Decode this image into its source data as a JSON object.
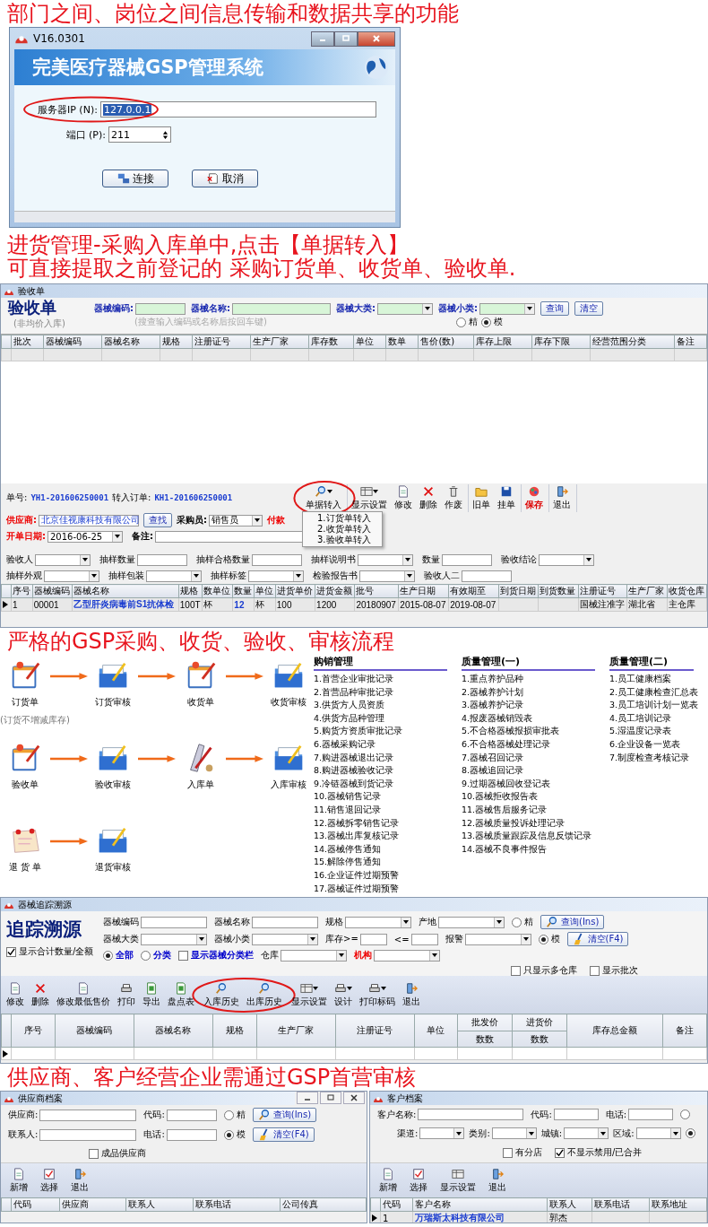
{
  "caption_top": "部门之间、岗位之间信息传输和数据共享的功能",
  "login_window": {
    "title": "V16.0301",
    "banner": "完美医疗器械GSP管理系统",
    "server": {
      "label": "服务器IP (N):",
      "value": "127.0.0.1",
      "highlighted": true
    },
    "port": {
      "label": "端口 (P):",
      "value": "211"
    },
    "buttons": [
      {
        "label": "连接",
        "kind": "connect"
      },
      {
        "label": "取消",
        "kind": "cancel"
      }
    ]
  },
  "caption_purchase": [
    "进货管理-采购入库单中,点击【单据转入】",
    "可直接提取之前登记的 采购订货单、收货单、验收单."
  ],
  "inspection_window": {
    "title": "验收单",
    "heading": "验收单",
    "subheading": "(非均价入库)",
    "filters": [
      {
        "kind": "text",
        "label": "器械编码:"
      },
      {
        "kind": "longtext",
        "label": "器械名称:"
      },
      {
        "kind": "select",
        "label": "器械大类:"
      },
      {
        "kind": "select",
        "label": "器械小类:"
      }
    ],
    "hint": "(搜查输入编码或名称后按回车键)",
    "buttons": [
      "查询",
      "清空"
    ],
    "match_modes": [
      {
        "kind": "radio",
        "label": "精",
        "selected": false
      },
      {
        "kind": "radio",
        "label": "模",
        "selected": true
      }
    ],
    "columns": [
      "批次",
      "器械编码",
      "器械名称",
      "规格",
      "注册证号",
      "生产厂家",
      "库存数",
      "单位",
      "数单",
      "售价(数)",
      "库存上限",
      "库存下限",
      "经营范围分类",
      "备注"
    ]
  },
  "bill": {
    "number_label": "单号:",
    "number": "YH1-201606250001",
    "source_label": "转入订单:",
    "source": "KH1-201606250001",
    "toolbar": [
      {
        "circled": true,
        "items": [
          {
            "label": "单据转入",
            "kind": "transfer",
            "dropdown": true
          }
        ]
      },
      {
        "circled": false,
        "items": [
          {
            "label": "显示设置",
            "kind": "display",
            "dropdown": true
          },
          {
            "label": "修改",
            "kind": "edit",
            "dropdown": false
          },
          {
            "label": "删除",
            "kind": "delete",
            "dropdown": false
          },
          {
            "label": "作废",
            "kind": "void",
            "dropdown": false
          }
        ]
      },
      {
        "circled": false,
        "items": [
          {
            "label": "旧单",
            "kind": "open",
            "dropdown": false
          },
          {
            "label": "挂单",
            "kind": "hold",
            "dropdown": false
          }
        ]
      },
      {
        "circled": false,
        "items": [
          {
            "label": "保存",
            "kind": "save",
            "dropdown": false,
            "color": "#dd0000"
          }
        ]
      },
      {
        "circled": false,
        "items": [
          {
            "label": "退出",
            "kind": "exit",
            "dropdown": false
          }
        ]
      }
    ],
    "menu": [
      "1.订货单转入",
      "2.收货单转入",
      "3.验收单转入"
    ],
    "form_rows": [
      [
        {
          "kind": "lookup",
          "label": "供应商:",
          "color": "#ee0000",
          "value": "北京佳视康科技有限公司"
        },
        {
          "kind": "button",
          "label": "查找"
        },
        {
          "kind": "select",
          "label": "采购员:",
          "value": "销售员"
        },
        {
          "kind": "label",
          "label": "付款",
          "color": "#ee0000"
        }
      ],
      [
        {
          "kind": "select",
          "label": "开单日期:",
          "color": "#ee0000",
          "value": "2016-06-25"
        },
        {
          "kind": "wide",
          "label": "备注:"
        }
      ],
      [
        {
          "kind": "select",
          "label": "验收人"
        },
        {
          "kind": "text",
          "label": "抽样数量"
        },
        {
          "kind": "text",
          "label": "抽样合格数量"
        },
        {
          "kind": "select",
          "label": "抽样说明书"
        },
        {
          "kind": "text",
          "label": "数量"
        },
        {
          "kind": "select",
          "label": "验收结论"
        }
      ],
      [
        {
          "kind": "select",
          "label": "抽样外观"
        },
        {
          "kind": "select",
          "label": "抽样包装"
        },
        {
          "kind": "select",
          "label": "抽样标签"
        },
        {
          "kind": "select",
          "label": "检验报告书"
        },
        {
          "kind": "text",
          "label": "验收人二"
        }
      ]
    ],
    "columns": [
      "序号",
      "器械编码",
      "器械名称",
      "规格",
      "数单位",
      "数量",
      "单位",
      "进货单价",
      "进货金额",
      "批号",
      "生产日期",
      "有效期至",
      "到货日期",
      "到货数量",
      "注册证号",
      "生产厂家",
      "收货仓库"
    ],
    "rows": [
      [
        {
          "text": "1"
        },
        {
          "text": "00001"
        },
        {
          "text": "乙型肝炎病毒前S1抗体检",
          "color": "#1a3cd0"
        },
        {
          "text": "100T"
        },
        {
          "text": "杯"
        },
        {
          "text": "12",
          "color": "#1a3cd0"
        },
        {
          "text": "杯"
        },
        {
          "text": "100"
        },
        {
          "text": "1200"
        },
        {
          "text": "20180907"
        },
        {
          "text": "2015-08-07"
        },
        {
          "text": "2019-08-07"
        },
        null,
        null,
        {
          "text": "国械注准字"
        },
        {
          "text": "湖北省"
        },
        {
          "text": "主仓库"
        }
      ]
    ]
  },
  "caption_flow": "严格的GSP采购、收货、验收、审核流程",
  "flow": {
    "rows": [
      {
        "nodes": [
          {
            "label": "订货单",
            "kind": "notepad"
          },
          {
            "label": "订货审核",
            "kind": "folder"
          },
          {
            "label": "收货单",
            "kind": "notepad"
          },
          {
            "label": "收货审核",
            "kind": "folder"
          }
        ],
        "note": "(订货不增减库存)"
      },
      {
        "nodes": [
          {
            "label": "验收单",
            "kind": "notepad"
          },
          {
            "label": "验收审核",
            "kind": "folder"
          },
          {
            "label": "入库单",
            "kind": "tools"
          },
          {
            "label": "入库审核",
            "kind": "folder"
          }
        ]
      },
      {
        "nodes": [
          {
            "label": "退 货 单",
            "kind": "note"
          },
          {
            "label": "退货审核",
            "kind": "folder"
          }
        ]
      }
    ]
  },
  "report_lists": [
    {
      "title": "购销管理",
      "items": [
        "1.首营企业审批记录",
        "2.首营品种审批记录",
        "3.供货方人员资质",
        "4.供货方品种管理",
        "5.购货方资质审批记录",
        "6.器械采购记录",
        "7.购进器械退出记录",
        "8.购进器械验收记录",
        "9.冷链器械到货记录",
        "10.器械销售记录",
        "11.销售退回记录",
        "12.器械拆零销售记录",
        "13.器械出库复核记录",
        "14.器械停售通知",
        "15.解除停售通知",
        "16.企业证件过期预警",
        "17.器械证件过期预警"
      ]
    },
    {
      "title": "质量管理(一)",
      "items": [
        "1.重点养护品种",
        "2.器械养护计划",
        "3.器械养护记录",
        "4.报废器械销毁表",
        "5.不合格器械报损审批表",
        "6.不合格器械处理记录",
        "7.器械召回记录",
        "8.器械追回记录",
        "9.过期器械回收登记表",
        "10.器械拒收报告表",
        "11.器械售后服务记录",
        "12.器械质量投诉处理记录",
        "13.器械质量跟踪及信息反馈记录",
        "14.器械不良事件报告"
      ]
    },
    {
      "title": "质量管理(二)",
      "items": [
        "1.员工健康档案",
        "2.员工健康检查汇总表",
        "3.员工培训计划一览表",
        "4.员工培训记录",
        "5.湿温度记录表",
        "6.企业设备一览表",
        "7.制度检查考核记录"
      ]
    }
  ],
  "trace_window": {
    "title": "器械追踪溯源",
    "heading": "追踪溯源",
    "summary_checkbox": {
      "kind": "checkbox",
      "label": "显示合计数量/全额",
      "checked": true
    },
    "filter_rows": [
      [
        {
          "kind": "text",
          "label": "器械编码"
        },
        {
          "kind": "text",
          "label": "器械名称"
        },
        {
          "kind": "select",
          "label": "规格"
        },
        {
          "kind": "select",
          "label": "产地"
        },
        {
          "kind": "radio",
          "label": "精",
          "selected": false
        },
        {
          "kind": "query",
          "label": "查询(Ins)"
        }
      ],
      [
        {
          "kind": "select",
          "label": "器械大类"
        },
        {
          "kind": "select",
          "label": "器械小类"
        },
        {
          "kind": "short",
          "label": "库存>="
        },
        {
          "kind": "short",
          "label": "<="
        },
        {
          "kind": "select",
          "label": "报警"
        },
        {
          "kind": "radio",
          "label": "模",
          "selected": true
        },
        {
          "kind": "clear",
          "label": "清空(F4)"
        }
      ],
      [
        {
          "kind": "radio",
          "label": "全部",
          "selected": true,
          "color": "#0000cc"
        },
        {
          "kind": "radio",
          "label": "分类",
          "selected": false,
          "color": "#0000cc"
        },
        {
          "kind": "checkbox",
          "label": "显示器械分类栏",
          "checked": false,
          "color": "#0000cc"
        },
        {
          "kind": "select",
          "label": "仓库"
        },
        {
          "kind": "select",
          "label": "机构",
          "color": "#ee0000"
        }
      ],
      [
        {
          "kind": "checkbox",
          "label": "只显示多仓库",
          "checked": false
        },
        {
          "kind": "checkbox",
          "label": "显示批次",
          "checked": false
        }
      ]
    ],
    "toolbar": [
      {
        "circled": false,
        "items": [
          {
            "label": "修改",
            "kind": "edit",
            "dropdown": false
          },
          {
            "label": "删除",
            "kind": "delete",
            "dropdown": false
          },
          {
            "label": "修改最低售价",
            "kind": "edit",
            "dropdown": false
          },
          {
            "label": "打印",
            "kind": "print",
            "dropdown": false
          },
          {
            "label": "导出",
            "kind": "export",
            "dropdown": false
          },
          {
            "label": "盘点表",
            "kind": "export",
            "dropdown": false
          }
        ]
      },
      {
        "circled": true,
        "items": [
          {
            "label": "入库历史",
            "kind": "history",
            "dropdown": false
          },
          {
            "label": "出库历史",
            "kind": "history",
            "dropdown": false
          }
        ]
      },
      {
        "circled": false,
        "items": [
          {
            "label": "显示设置",
            "kind": "display",
            "dropdown": true
          },
          {
            "label": "设计",
            "kind": "print",
            "dropdown": true
          },
          {
            "label": "打印标码",
            "kind": "print",
            "dropdown": true
          },
          {
            "label": "退出",
            "kind": "exit",
            "dropdown": false
          }
        ]
      }
    ],
    "columns": [
      {
        "label": "序号"
      },
      {
        "label": "器械编码"
      },
      {
        "label": "器械名称"
      },
      {
        "label": "规格"
      },
      {
        "label": "生产厂家"
      },
      {
        "label": "注册证号"
      },
      {
        "label": "单位"
      },
      {
        "label": "批发价",
        "sub": "数数"
      },
      {
        "label": "进货价",
        "sub": "数数"
      },
      {
        "label": "库存总金额"
      },
      {
        "label": "备注"
      }
    ]
  },
  "caption_audit": "供应商、客户经营企业需通过GSP首营审核",
  "supplier_window": {
    "title": "供应商档案",
    "filter_rows": [
      [
        {
          "kind": "longtext",
          "label": "供应商:"
        },
        {
          "kind": "text",
          "label": "代码:"
        },
        {
          "kind": "radio",
          "label": "精",
          "selected": false
        },
        {
          "kind": "query",
          "label": "查询(Ins)"
        }
      ],
      [
        {
          "kind": "longtext",
          "label": "联系人:"
        },
        {
          "kind": "text",
          "label": "电话:"
        },
        {
          "kind": "radio",
          "label": "模",
          "selected": true
        },
        {
          "kind": "clear",
          "label": "清空(F4)"
        }
      ],
      [
        {
          "kind": "checkbox",
          "label": "成品供应商",
          "checked": false
        }
      ]
    ],
    "toolbar": [
      {
        "label": "新增",
        "kind": "add",
        "dropdown": false
      },
      {
        "label": "选择",
        "kind": "select",
        "dropdown": false
      },
      {
        "label": "退出",
        "kind": "exit",
        "dropdown": false
      }
    ],
    "columns": [
      "代码",
      "供应商",
      "联系人",
      "联系电话",
      "公司传真"
    ]
  },
  "customer_window": {
    "title": "客户档案",
    "filter_rows": [
      [
        {
          "kind": "longtext",
          "label": "客户名称:"
        },
        {
          "kind": "text",
          "label": "代码:"
        },
        {
          "kind": "text",
          "label": "电话:"
        },
        {
          "kind": "radio",
          "selected": false
        }
      ],
      [
        {
          "kind": "select",
          "label": "渠道:"
        },
        {
          "kind": "select",
          "label": "类别:"
        },
        {
          "kind": "select",
          "label": "城镇:"
        },
        {
          "kind": "select",
          "label": "区域:"
        },
        {
          "kind": "radio",
          "selected": true
        }
      ],
      [
        {
          "kind": "checkbox",
          "label": "有分店",
          "checked": false
        },
        {
          "kind": "checkbox",
          "label": "不显示禁用/已合并",
          "checked": true
        }
      ]
    ],
    "toolbar": [
      {
        "label": "新增",
        "kind": "add",
        "dropdown": false
      },
      {
        "label": "选择",
        "kind": "select",
        "dropdown": false
      },
      {
        "label": "显示设置",
        "kind": "display",
        "dropdown": false
      },
      {
        "label": "退出",
        "kind": "exit",
        "dropdown": false
      }
    ],
    "columns": [
      "代码",
      "客户名称",
      "联系人",
      "联系电话",
      "联系地址"
    ],
    "rows": [
      [
        {
          "text": "1"
        },
        {
          "text": "万瑞斯太科技有限公司",
          "color": "#1a3cd0"
        },
        {
          "text": "郭杰"
        },
        null,
        null
      ]
    ]
  }
}
